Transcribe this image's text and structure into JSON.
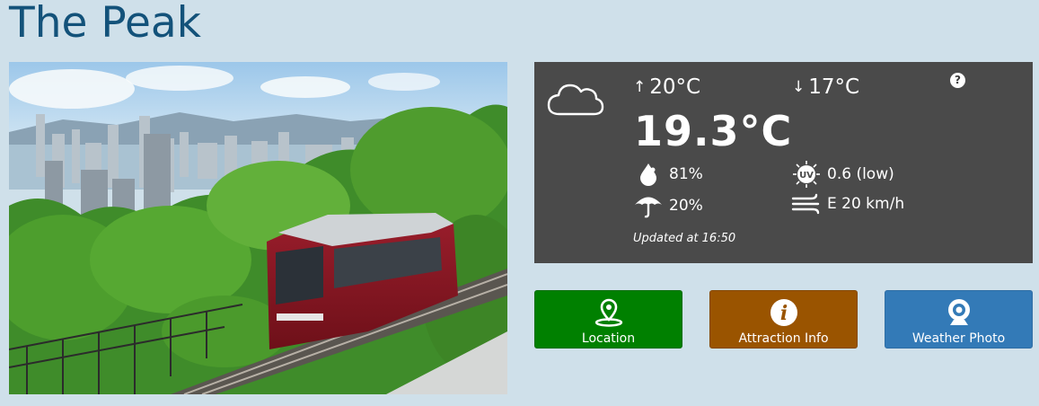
{
  "page": {
    "title": "The Peak"
  },
  "photo": {
    "alt": "Peak Tram on Victoria Peak, Hong Kong"
  },
  "weather": {
    "icon": "cloud-icon",
    "high": "20°C",
    "low": "17°C",
    "current": "19.3°C",
    "humidity": "81%",
    "rain_chance": "20%",
    "uv": "0.6 (low)",
    "wind": "E 20 km/h",
    "updated": "Updated at 16:50",
    "help": "?"
  },
  "buttons": {
    "location": "Location",
    "attraction_info": "Attraction Info",
    "weather_photo": "Weather Photo"
  },
  "colors": {
    "background": "#cfe0ea",
    "title": "#13527a",
    "weather_panel": "#4a4a4a",
    "location": "#008000",
    "attraction_info": "#9a5400",
    "weather_photo": "#337ab7"
  }
}
